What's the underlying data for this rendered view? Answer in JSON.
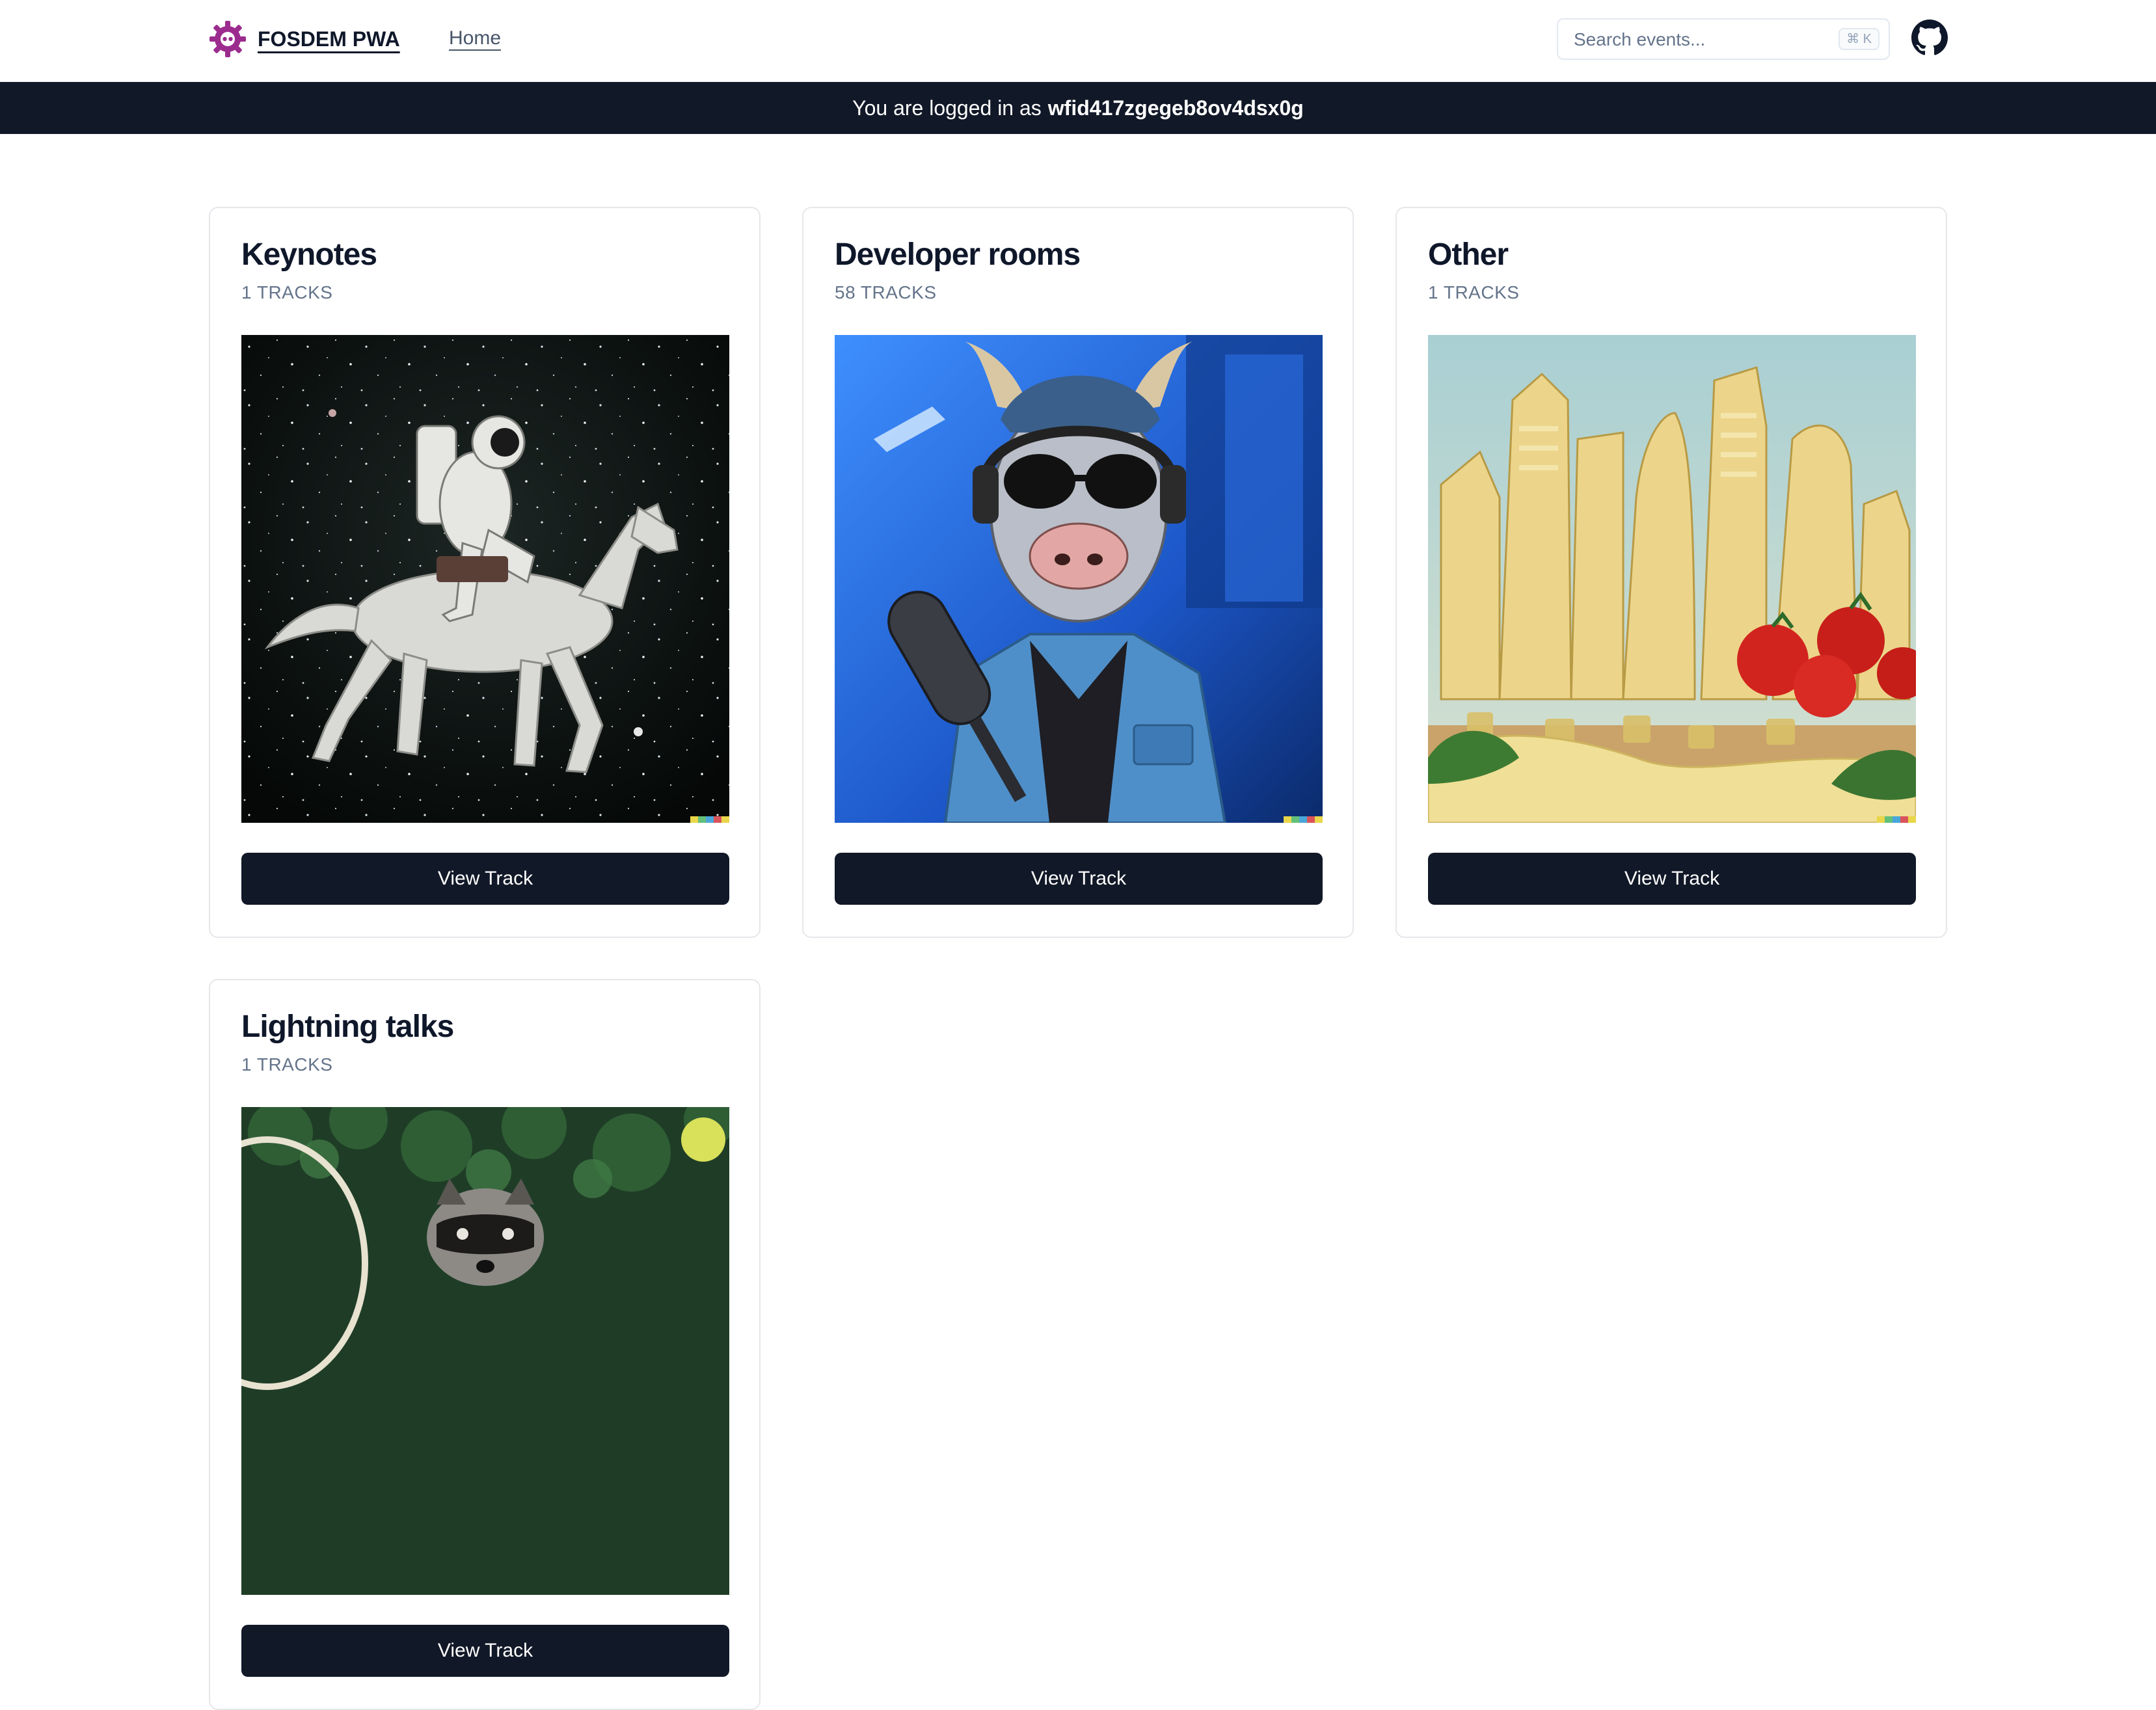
{
  "header": {
    "brand": "FOSDEM PWA",
    "nav_home": "Home",
    "search_placeholder": "Search events...",
    "search_shortcut": "⌘ K"
  },
  "banner": {
    "prefix": "You are logged in as",
    "username": "wfid417zgegeb8ov4dsx0g"
  },
  "cards": [
    {
      "title": "Keynotes",
      "subtitle": "1 TRACKS",
      "button": "View Track",
      "image": "astronaut-on-horse-in-space"
    },
    {
      "title": "Developer rooms",
      "subtitle": "58 TRACKS",
      "button": "View Track",
      "image": "cow-with-sunglasses-podcasting"
    },
    {
      "title": "Other",
      "subtitle": "1 TRACKS",
      "button": "View Track",
      "image": "cheese-pasta-city-with-tomatoes"
    },
    {
      "title": "Lightning talks",
      "subtitle": "1 TRACKS",
      "button": "View Track",
      "image": "raccoon-playing-tennis"
    }
  ],
  "colors": {
    "banner_bg": "#111827",
    "button_bg": "#111827",
    "brand_purple": "#9b2c8e",
    "border": "#e5e7eb"
  },
  "icons": [
    "fosdem-logo-icon",
    "github-icon"
  ]
}
